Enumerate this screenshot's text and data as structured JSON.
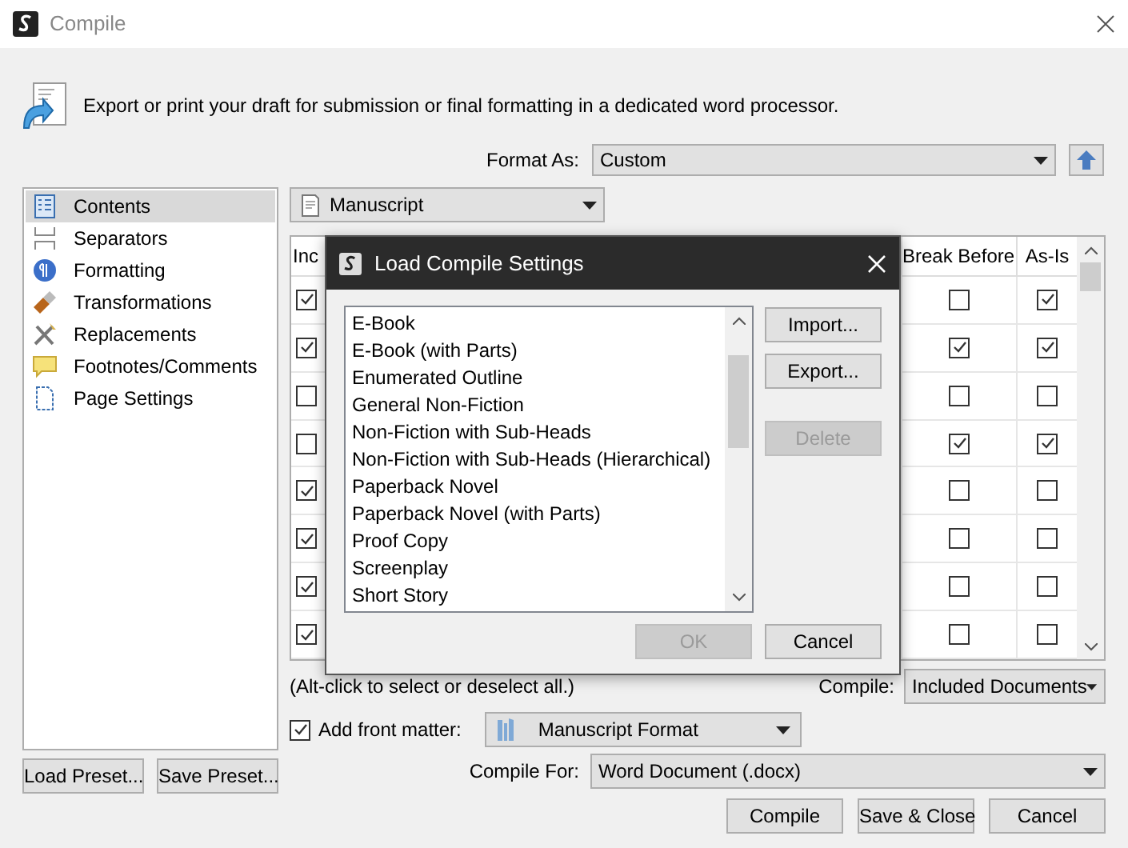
{
  "window": {
    "title": "Compile"
  },
  "header": {
    "text": "Export or print your draft for submission or final formatting in a dedicated word processor."
  },
  "format_as": {
    "label": "Format As:",
    "value": "Custom"
  },
  "sidebar": {
    "items": [
      {
        "label": "Contents",
        "selected": true
      },
      {
        "label": "Separators",
        "selected": false
      },
      {
        "label": "Formatting",
        "selected": false
      },
      {
        "label": "Transformations",
        "selected": false
      },
      {
        "label": "Replacements",
        "selected": false
      },
      {
        "label": "Footnotes/Comments",
        "selected": false
      },
      {
        "label": "Page Settings",
        "selected": false
      }
    ]
  },
  "section_dropdown": {
    "value": "Manuscript"
  },
  "table": {
    "columns": [
      "Inc",
      "Break Before",
      "As-Is"
    ],
    "rows": [
      {
        "include": true,
        "break_before": false,
        "as_is": true
      },
      {
        "include": true,
        "break_before": true,
        "as_is": true
      },
      {
        "include": false,
        "break_before": false,
        "as_is": false
      },
      {
        "include": false,
        "break_before": true,
        "as_is": true
      },
      {
        "include": true,
        "break_before": false,
        "as_is": false
      },
      {
        "include": true,
        "break_before": false,
        "as_is": false
      },
      {
        "include": true,
        "break_before": false,
        "as_is": false
      },
      {
        "include": true,
        "break_before": false,
        "as_is": false
      }
    ]
  },
  "dialog": {
    "title": "Load Compile Settings",
    "list": [
      "E-Book",
      "E-Book (with Parts)",
      "Enumerated Outline",
      "General Non-Fiction",
      "Non-Fiction with Sub-Heads",
      "Non-Fiction with Sub-Heads (Hierarchical)",
      "Paperback Novel",
      "Paperback Novel (with Parts)",
      "Proof Copy",
      "Screenplay",
      "Short Story"
    ],
    "side_buttons": [
      {
        "label": "Import...",
        "disabled": false
      },
      {
        "label": "Export...",
        "disabled": false
      },
      {
        "label": "Delete",
        "disabled": true
      }
    ],
    "footer_buttons": [
      {
        "label": "OK",
        "disabled": true
      },
      {
        "label": "Cancel",
        "disabled": false
      }
    ]
  },
  "hint": "(Alt-click to select or deselect all.)",
  "compile": {
    "label": "Compile:",
    "value": "Included Documents"
  },
  "front_matter": {
    "label": "Add front matter:",
    "checked": true,
    "value": "Manuscript Format"
  },
  "compile_for": {
    "label": "Compile For:",
    "value": "Word Document (.docx)"
  },
  "preset_buttons": [
    "Load Preset...",
    "Save Preset..."
  ],
  "buttons": [
    "Compile",
    "Save & Close",
    "Cancel"
  ]
}
